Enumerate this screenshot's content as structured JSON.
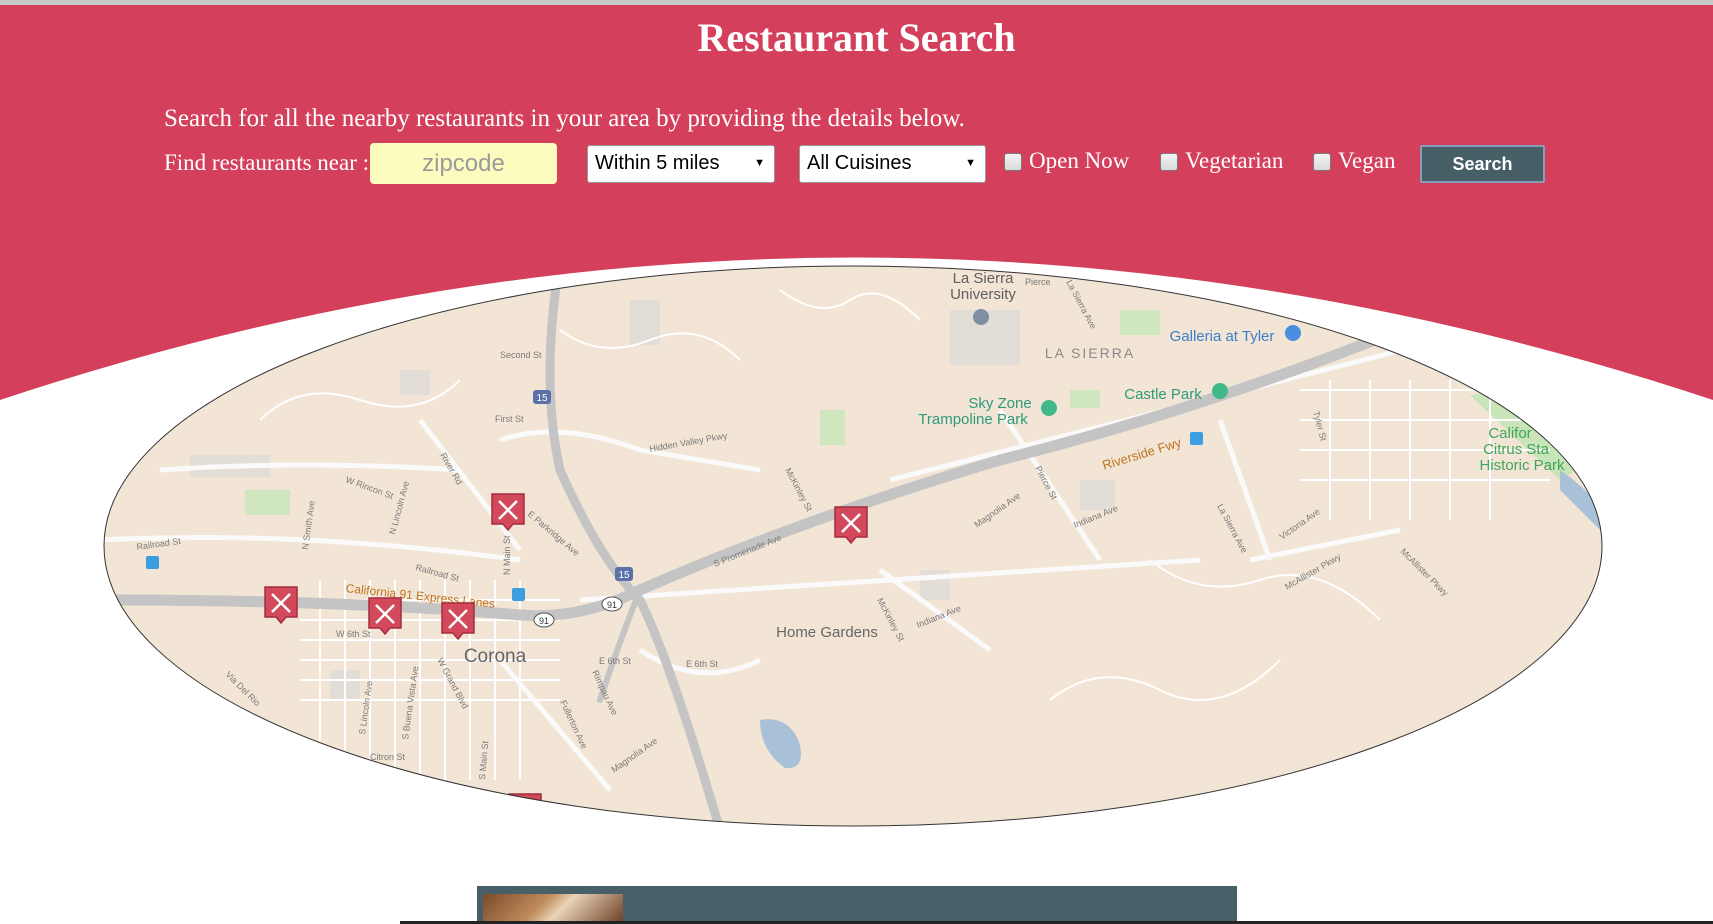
{
  "header": {
    "title": "Restaurant Search",
    "subtitle": "Search for all the nearby restaurants in your area by providing the details below.",
    "bg_color": "#d43f5c"
  },
  "search_form": {
    "find_label": "Find restaurants near :",
    "zip_placeholder": "zipcode",
    "zip_value": "",
    "distance_selected": "Within 5 miles",
    "cuisine_selected": "All Cuisines",
    "checkboxes": [
      {
        "label": "Open Now",
        "checked": false
      },
      {
        "label": "Vegetarian",
        "checked": false
      },
      {
        "label": "Vegan",
        "checked": false
      }
    ],
    "search_button": "Search"
  },
  "map": {
    "place_labels": {
      "la_sierra_university_1": "La Sierra",
      "la_sierra_university_2": "University",
      "galleria": "Galleria at Tyler",
      "la_sierra_district": "LA SIERRA",
      "castle_park": "Castle Park",
      "sky_zone_1": "Sky Zone",
      "sky_zone_2": "Trampoline Park",
      "citrus_1": "Califor",
      "citrus_2": "Citrus Sta",
      "citrus_3": "Historic Park",
      "corona": "Corona",
      "home_gardens": "Home Gardens",
      "riverside_fwy": "Riverside Fwy",
      "ca91_express": "California 91 Express Lanes"
    },
    "street_labels": {
      "second_st": "Second St",
      "first_st": "First St",
      "hidden_valley": "Hidden Valley Pkwy",
      "w_rincon": "W Rincon St",
      "river_rd": "River Rd",
      "n_lincoln": "N Lincoln Ave",
      "n_smith": "N Smith Ave",
      "railroad_st": "Railroad St",
      "railroad_st_2": "Railroad St",
      "e_parkridge": "E Parkridge Ave",
      "n_main": "N Main St",
      "s_promenade": "S Promenade Ave",
      "mckinley": "McKinley St",
      "mckinley_2": "McKinley St",
      "magnolia": "Magnolia Ave",
      "magnolia_2": "Magnolia Ave",
      "pierce": "Pierce St",
      "indiana": "Indiana Ave",
      "indiana_2": "Indiana Ave",
      "la_sierra_ave": "La Sierra Ave",
      "la_sierra_ave_2": "La Sierra Ave",
      "victoria": "Victoria Ave",
      "tyler": "Tyler St",
      "mcallister": "McAllister Pkwy",
      "mcallister_2": "McAllister Pkwy",
      "w_6th": "W 6th St",
      "e_6th": "E 6th St",
      "e_6th_2": "E 6th St",
      "rimpau": "Rimpau Ave",
      "fullerton": "Fullerton Ave",
      "citron": "Citron St",
      "s_lincoln": "S Lincoln Ave",
      "s_buena_vista": "S Buena Vista Ave",
      "w_grand": "W Grand Blvd",
      "s_main": "S Main St",
      "via_del_rio": "Via Del Rio",
      "pierce_top": "Pierce",
      "route_15": "15",
      "route_91": "91",
      "route_91_b": "91"
    },
    "restaurant_markers": 6,
    "colors": {
      "land": "#f2e5d5",
      "road": "#ffffff",
      "freeway": "#c4c4c4",
      "marker": "#d1495b",
      "park": "#bfe0b0",
      "water": "#a6bfd6"
    }
  }
}
